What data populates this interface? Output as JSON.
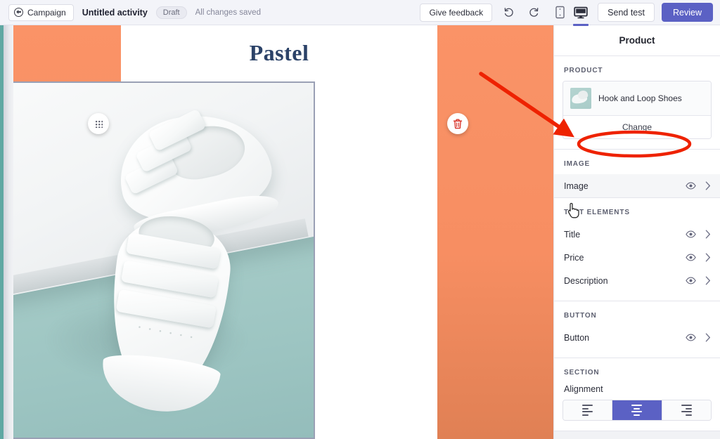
{
  "topbar": {
    "campaign_label": "Campaign",
    "activity_title": "Untitled activity",
    "draft_badge": "Draft",
    "saved_text": "All changes saved",
    "feedback_label": "Give feedback",
    "undo_icon": "undo-icon",
    "redo_icon": "redo-icon",
    "mobile_icon": "mobile-device-icon",
    "desktop_icon": "desktop-device-icon",
    "active_device": "desktop",
    "send_test_label": "Send test",
    "review_label": "Review",
    "accent_color": "#5b61c4",
    "background_color": "#f3f4f9"
  },
  "canvas": {
    "brand_logo": "Pastel",
    "background_color": "#f78e62",
    "drag_handle_icon": "drag-dots-icon",
    "delete_handle_icon": "trash-icon",
    "hero_alt": "White hook and loop sneakers on a white platform with teal background"
  },
  "panel": {
    "title": "Product",
    "product": {
      "section_label": "PRODUCT",
      "item_name": "Hook and Loop Shoes",
      "thumb_icon": "product-thumbnail",
      "change_label": "Change"
    },
    "image": {
      "section_label": "IMAGE",
      "rows": [
        {
          "label": "Image",
          "eye_icon": "eye-icon",
          "chevron_icon": "chevron-right-icon"
        }
      ]
    },
    "text_elements": {
      "section_label": "TEXT ELEMENTS",
      "rows": [
        {
          "label": "Title",
          "eye_icon": "eye-icon",
          "chevron_icon": "chevron-right-icon"
        },
        {
          "label": "Price",
          "eye_icon": "eye-icon",
          "chevron_icon": "chevron-right-icon"
        },
        {
          "label": "Description",
          "eye_icon": "eye-icon",
          "chevron_icon": "chevron-right-icon"
        }
      ]
    },
    "button": {
      "section_label": "BUTTON",
      "rows": [
        {
          "label": "Button",
          "eye_icon": "eye-icon",
          "chevron_icon": "chevron-right-icon"
        }
      ]
    },
    "section": {
      "section_label": "SECTION",
      "alignment_label": "Alignment",
      "options": [
        {
          "value": "left",
          "icon": "align-left-icon",
          "selected": false
        },
        {
          "value": "center",
          "icon": "align-center-icon",
          "selected": true
        },
        {
          "value": "right",
          "icon": "align-right-icon",
          "selected": false
        }
      ],
      "selected_color": "#5b61c4"
    }
  },
  "annotations": {
    "arrow_color": "#ee2200",
    "ellipse_color": "#ee2200",
    "arrow_icon": "red-pointer-arrow",
    "ellipse_icon": "red-highlight-ellipse",
    "target": "Change"
  }
}
